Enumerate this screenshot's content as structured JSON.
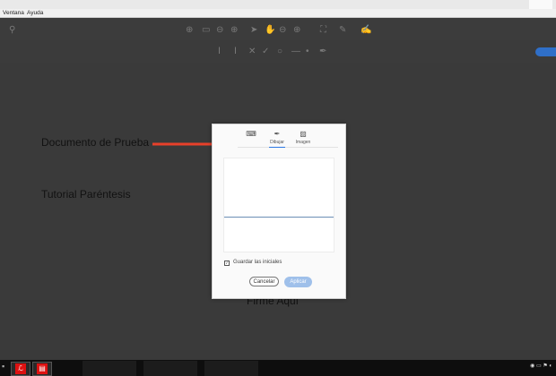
{
  "window": {
    "title": ""
  },
  "menubar": {
    "items": [
      "Ventana",
      "Ayuda"
    ]
  },
  "document": {
    "line1": "Documento de Prueba",
    "line2": "Tutorial Paréntesis",
    "line3": "Firme Aquí"
  },
  "dialog": {
    "tabs": [
      {
        "label": "",
        "icon": "keyboard-icon"
      },
      {
        "label": "Dibujar",
        "icon": "pen-icon"
      },
      {
        "label": "Imagen",
        "icon": "image-icon"
      }
    ],
    "save_initials_label": "Guardar las iniciales",
    "save_initials_checked": true,
    "cancel_label": "Cancelar",
    "apply_label": "Aplicar"
  },
  "colors": {
    "accent": "#2b78e4",
    "apply_button": "#9fc0ea",
    "arrow": "#e8402a",
    "background": "#3a3a3a"
  }
}
